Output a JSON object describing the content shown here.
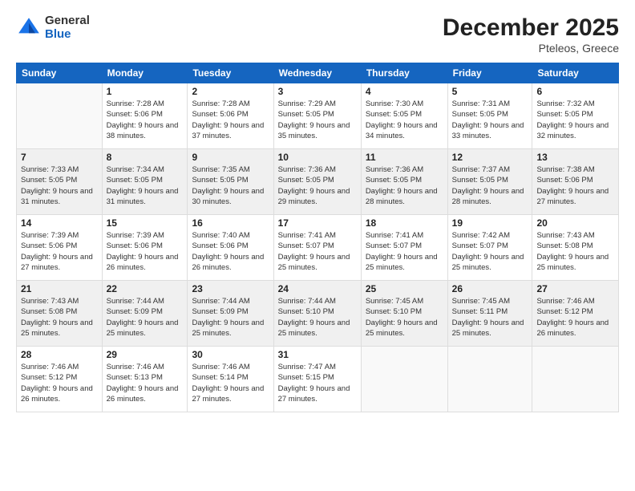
{
  "logo": {
    "general": "General",
    "blue": "Blue"
  },
  "header": {
    "month": "December 2025",
    "location": "Pteleos, Greece"
  },
  "weekdays": [
    "Sunday",
    "Monday",
    "Tuesday",
    "Wednesday",
    "Thursday",
    "Friday",
    "Saturday"
  ],
  "weeks": [
    [
      {
        "day": "",
        "empty": true
      },
      {
        "day": "1",
        "sunrise": "7:28 AM",
        "sunset": "5:06 PM",
        "daylight": "9 hours and 38 minutes."
      },
      {
        "day": "2",
        "sunrise": "7:28 AM",
        "sunset": "5:06 PM",
        "daylight": "9 hours and 37 minutes."
      },
      {
        "day": "3",
        "sunrise": "7:29 AM",
        "sunset": "5:05 PM",
        "daylight": "9 hours and 35 minutes."
      },
      {
        "day": "4",
        "sunrise": "7:30 AM",
        "sunset": "5:05 PM",
        "daylight": "9 hours and 34 minutes."
      },
      {
        "day": "5",
        "sunrise": "7:31 AM",
        "sunset": "5:05 PM",
        "daylight": "9 hours and 33 minutes."
      },
      {
        "day": "6",
        "sunrise": "7:32 AM",
        "sunset": "5:05 PM",
        "daylight": "9 hours and 32 minutes."
      }
    ],
    [
      {
        "day": "7",
        "sunrise": "7:33 AM",
        "sunset": "5:05 PM",
        "daylight": "9 hours and 31 minutes."
      },
      {
        "day": "8",
        "sunrise": "7:34 AM",
        "sunset": "5:05 PM",
        "daylight": "9 hours and 31 minutes."
      },
      {
        "day": "9",
        "sunrise": "7:35 AM",
        "sunset": "5:05 PM",
        "daylight": "9 hours and 30 minutes."
      },
      {
        "day": "10",
        "sunrise": "7:36 AM",
        "sunset": "5:05 PM",
        "daylight": "9 hours and 29 minutes."
      },
      {
        "day": "11",
        "sunrise": "7:36 AM",
        "sunset": "5:05 PM",
        "daylight": "9 hours and 28 minutes."
      },
      {
        "day": "12",
        "sunrise": "7:37 AM",
        "sunset": "5:05 PM",
        "daylight": "9 hours and 28 minutes."
      },
      {
        "day": "13",
        "sunrise": "7:38 AM",
        "sunset": "5:06 PM",
        "daylight": "9 hours and 27 minutes."
      }
    ],
    [
      {
        "day": "14",
        "sunrise": "7:39 AM",
        "sunset": "5:06 PM",
        "daylight": "9 hours and 27 minutes."
      },
      {
        "day": "15",
        "sunrise": "7:39 AM",
        "sunset": "5:06 PM",
        "daylight": "9 hours and 26 minutes."
      },
      {
        "day": "16",
        "sunrise": "7:40 AM",
        "sunset": "5:06 PM",
        "daylight": "9 hours and 26 minutes."
      },
      {
        "day": "17",
        "sunrise": "7:41 AM",
        "sunset": "5:07 PM",
        "daylight": "9 hours and 25 minutes."
      },
      {
        "day": "18",
        "sunrise": "7:41 AM",
        "sunset": "5:07 PM",
        "daylight": "9 hours and 25 minutes."
      },
      {
        "day": "19",
        "sunrise": "7:42 AM",
        "sunset": "5:07 PM",
        "daylight": "9 hours and 25 minutes."
      },
      {
        "day": "20",
        "sunrise": "7:43 AM",
        "sunset": "5:08 PM",
        "daylight": "9 hours and 25 minutes."
      }
    ],
    [
      {
        "day": "21",
        "sunrise": "7:43 AM",
        "sunset": "5:08 PM",
        "daylight": "9 hours and 25 minutes."
      },
      {
        "day": "22",
        "sunrise": "7:44 AM",
        "sunset": "5:09 PM",
        "daylight": "9 hours and 25 minutes."
      },
      {
        "day": "23",
        "sunrise": "7:44 AM",
        "sunset": "5:09 PM",
        "daylight": "9 hours and 25 minutes."
      },
      {
        "day": "24",
        "sunrise": "7:44 AM",
        "sunset": "5:10 PM",
        "daylight": "9 hours and 25 minutes."
      },
      {
        "day": "25",
        "sunrise": "7:45 AM",
        "sunset": "5:10 PM",
        "daylight": "9 hours and 25 minutes."
      },
      {
        "day": "26",
        "sunrise": "7:45 AM",
        "sunset": "5:11 PM",
        "daylight": "9 hours and 25 minutes."
      },
      {
        "day": "27",
        "sunrise": "7:46 AM",
        "sunset": "5:12 PM",
        "daylight": "9 hours and 26 minutes."
      }
    ],
    [
      {
        "day": "28",
        "sunrise": "7:46 AM",
        "sunset": "5:12 PM",
        "daylight": "9 hours and 26 minutes."
      },
      {
        "day": "29",
        "sunrise": "7:46 AM",
        "sunset": "5:13 PM",
        "daylight": "9 hours and 26 minutes."
      },
      {
        "day": "30",
        "sunrise": "7:46 AM",
        "sunset": "5:14 PM",
        "daylight": "9 hours and 27 minutes."
      },
      {
        "day": "31",
        "sunrise": "7:47 AM",
        "sunset": "5:15 PM",
        "daylight": "9 hours and 27 minutes."
      },
      {
        "day": "",
        "empty": true
      },
      {
        "day": "",
        "empty": true
      },
      {
        "day": "",
        "empty": true
      }
    ]
  ]
}
